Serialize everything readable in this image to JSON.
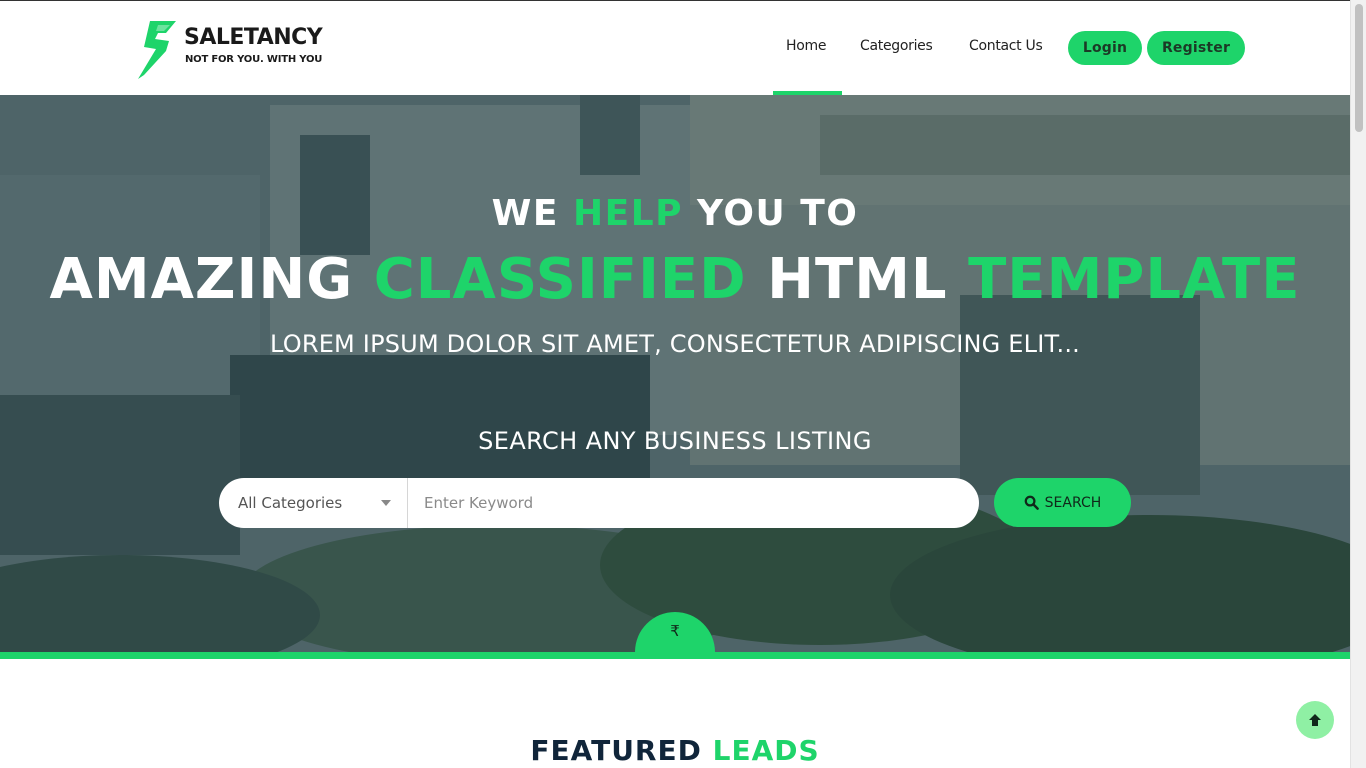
{
  "brand": {
    "name": "SALETANCY",
    "tagline": "NOT FOR YOU. WITH YOU",
    "accent_color": "#1ed46a"
  },
  "nav": {
    "items": [
      {
        "label": "Home",
        "active": true
      },
      {
        "label": "Categories",
        "active": false
      },
      {
        "label": "Contact Us",
        "active": false
      }
    ],
    "login_label": "Login",
    "register_label": "Register"
  },
  "hero": {
    "line1": {
      "part1": "WE ",
      "part2": "HELP",
      "part3": " YOU TO"
    },
    "line2": {
      "part1": "AMAZING ",
      "part2": "CLASSIFIED",
      "part3": " HTML ",
      "part4": "TEMPLATE"
    },
    "subtitle": "LOREM IPSUM DOLOR SIT AMET, CONSECTETUR ADIPISCING ELIT...",
    "search_heading": "SEARCH ANY BUSINESS LISTING"
  },
  "search": {
    "category_selected": "All Categories",
    "keyword_placeholder": "Enter Keyword",
    "button_label": "SEARCH",
    "button_icon": "search-icon"
  },
  "rupee_tab": {
    "symbol": "₹"
  },
  "featured": {
    "part1": "FEATURED ",
    "part2": "LEADS"
  },
  "back_to_top_icon": "arrow-up-icon"
}
